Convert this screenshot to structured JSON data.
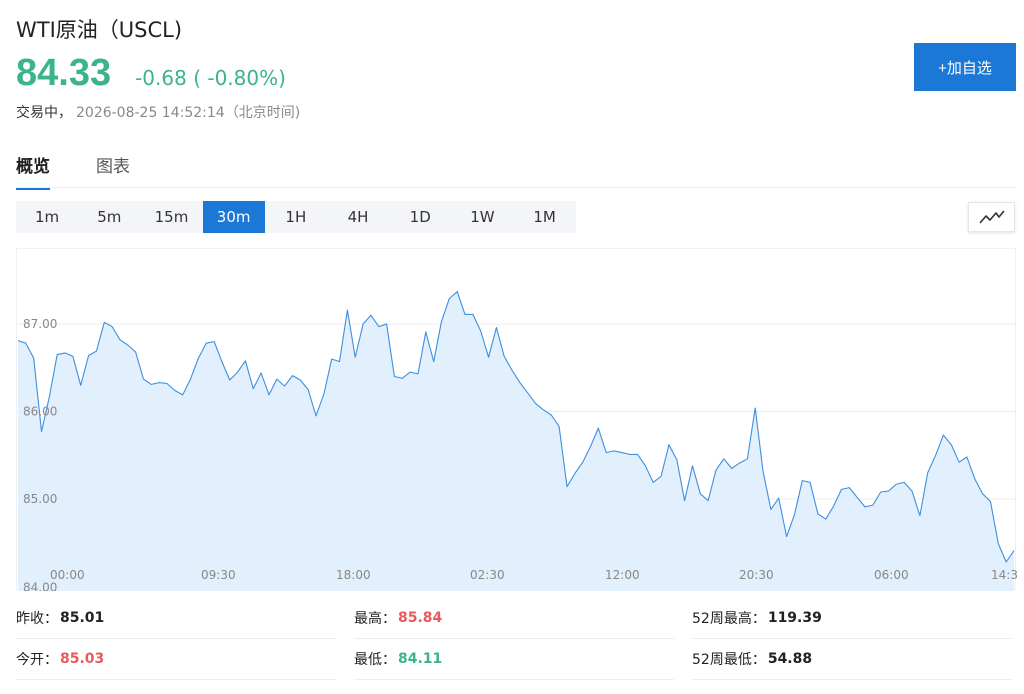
{
  "header": {
    "title": "WTI原油（USCL)",
    "price": "84.33",
    "change": "-0.68 ( -0.80%)",
    "status_label": "交易中，",
    "timestamp": "2026-08-25 14:52:14（北京时间)",
    "watch_button": "+加自选"
  },
  "tabs": [
    {
      "label": "概览",
      "active": true
    },
    {
      "label": "图表",
      "active": false
    }
  ],
  "periods": [
    "1m",
    "5m",
    "15m",
    "30m",
    "1H",
    "4H",
    "1D",
    "1W",
    "1M"
  ],
  "active_period": "30m",
  "icons": {
    "chart_type": "line-chart-icon"
  },
  "colors": {
    "up": "#ea5a5a",
    "down": "#3bb48d",
    "accent": "#1c78d6",
    "line": "#3d8fe0",
    "fill": "#e2effc"
  },
  "chart_data": {
    "type": "area",
    "y_ticks": [
      "87.00",
      "86.00",
      "85.00",
      "84.00"
    ],
    "ylim": [
      84.0,
      87.5
    ],
    "x_ticks": [
      "00:00",
      "09:30",
      "18:00",
      "02:30",
      "12:00",
      "20:30",
      "06:00",
      "14:3"
    ],
    "grid": true,
    "values": [
      86.81,
      86.78,
      86.61,
      85.77,
      86.17,
      86.65,
      86.67,
      86.63,
      86.3,
      86.64,
      86.69,
      87.02,
      86.97,
      86.82,
      86.76,
      86.68,
      86.37,
      86.31,
      86.33,
      86.32,
      86.24,
      86.19,
      86.37,
      86.61,
      86.78,
      86.8,
      86.57,
      86.36,
      86.45,
      86.58,
      86.26,
      86.44,
      86.19,
      86.37,
      86.29,
      86.41,
      86.36,
      86.25,
      85.95,
      86.2,
      86.6,
      86.57,
      87.16,
      86.62,
      87.0,
      87.1,
      86.97,
      87.0,
      86.4,
      86.38,
      86.45,
      86.43,
      86.91,
      86.57,
      87.03,
      87.29,
      87.37,
      87.11,
      87.11,
      86.92,
      86.62,
      86.96,
      86.63,
      86.47,
      86.33,
      86.21,
      86.09,
      86.02,
      85.96,
      85.83,
      85.14,
      85.29,
      85.42,
      85.6,
      85.81,
      85.53,
      85.55,
      85.53,
      85.51,
      85.51,
      85.38,
      85.19,
      85.26,
      85.62,
      85.45,
      84.98,
      85.38,
      85.06,
      84.98,
      85.33,
      85.46,
      85.35,
      85.41,
      85.46,
      86.04,
      85.32,
      84.88,
      85.01,
      84.57,
      84.82,
      85.21,
      85.19,
      84.83,
      84.77,
      84.92,
      85.11,
      85.13,
      85.02,
      84.91,
      84.93,
      85.08,
      85.09,
      85.17,
      85.19,
      85.09,
      84.81,
      85.3,
      85.5,
      85.73,
      85.62,
      85.42,
      85.48,
      85.23,
      85.06,
      84.97,
      84.49,
      84.28,
      84.41
    ]
  },
  "stats": [
    [
      {
        "label": "昨收：",
        "value": "85.01",
        "tone": "neutral"
      },
      {
        "label": "最高：",
        "value": "85.84",
        "tone": "up"
      },
      {
        "label": "52周最高：",
        "value": "119.39",
        "tone": "neutral"
      }
    ],
    [
      {
        "label": "今开：",
        "value": "85.03",
        "tone": "up"
      },
      {
        "label": "最低：",
        "value": "84.11",
        "tone": "down"
      },
      {
        "label": "52周最低：",
        "value": "54.88",
        "tone": "neutral"
      }
    ]
  ]
}
